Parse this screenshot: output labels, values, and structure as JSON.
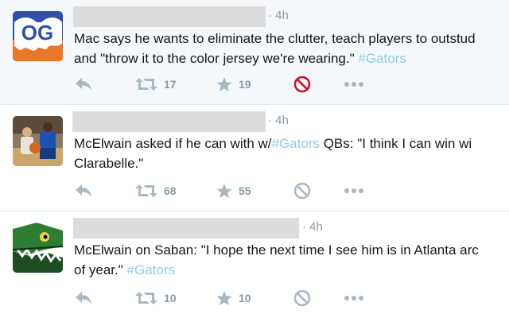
{
  "tweets": [
    {
      "avatar": "og-logo-avatar",
      "time": "· 4h",
      "text_lines": [
        [
          {
            "t": "Mac says he wants to eliminate the clutter, teach players to outstud"
          }
        ],
        [
          {
            "t": "and \"throw it to the color jersey we're wearing.\" "
          },
          {
            "t": "#Gators",
            "tag": true
          }
        ]
      ],
      "retweets": "17",
      "favorites": "19",
      "block_active": true
    },
    {
      "avatar": "player-photo-avatar",
      "time": "· 4h",
      "text_lines": [
        [
          {
            "t": "McElwain asked if he can with w/"
          },
          {
            "t": "#Gators",
            "tag": true
          },
          {
            "t": " QBs: \"I think I can win wi"
          }
        ],
        [
          {
            "t": "Clarabelle.\""
          }
        ]
      ],
      "retweets": "68",
      "favorites": "55",
      "block_active": false
    },
    {
      "avatar": "gator-mascot-avatar",
      "time": "· 4h",
      "text_lines": [
        [
          {
            "t": "McElwain on Saban: \"I hope the next time I see him is in Atlanta arc"
          }
        ],
        [
          {
            "t": "of year.\" "
          },
          {
            "t": "#Gators",
            "tag": true
          }
        ]
      ],
      "retweets": "10",
      "favorites": "10",
      "block_active": false
    }
  ],
  "colors": {
    "hashtag": "#91cbe8",
    "action_gray": "#aab8c2",
    "block_active": "#c8102e",
    "selected_bg": "#f5f8fa"
  },
  "icons": [
    "reply-icon",
    "retweet-icon",
    "favorite-star-icon",
    "block-icon",
    "more-dots-icon"
  ]
}
